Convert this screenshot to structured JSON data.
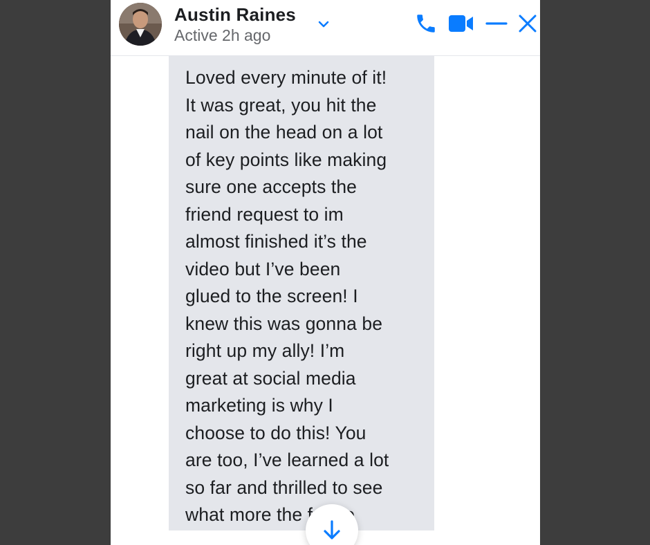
{
  "contact": {
    "name": "Austin Raines",
    "status": "Active 2h ago"
  },
  "icons": {
    "avatar": "avatar-photo",
    "chevron": "chevron-down-icon",
    "call": "phone-icon",
    "video": "video-camera-icon",
    "minimize": "minimize-icon",
    "close": "close-icon",
    "scroll": "arrow-down-icon"
  },
  "colors": {
    "accent": "#0a7cff",
    "bubble": "#e4e6eb",
    "backdrop": "#3d3d3d",
    "text": "#1c1e21",
    "muted": "#65676b"
  },
  "message": {
    "text": "Loved every minute of it!\nIt was great, you hit the\nnail on the head on a lot\nof key points like making\nsure one accepts the\nfriend request to im\nalmost finished it’s the\nvideo but I’ve been\nglued to the screen! I\nknew this was gonna be\nright up my ally! I’m\ngreat at social media\nmarketing is why I\nchoose to do this! You\nare too, I’ve learned a lot\nso far and thrilled to see\nwhat more the future"
  }
}
